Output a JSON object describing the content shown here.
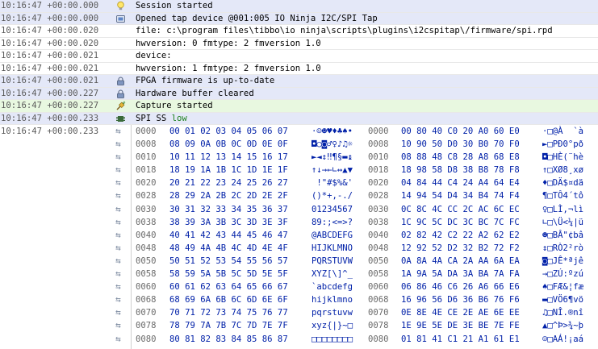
{
  "events": [
    {
      "ts": "10:16:47 +00:00.000",
      "icon": "lightbulb-icon",
      "tone": "blue",
      "text": "Session started",
      "hl": ""
    },
    {
      "ts": "10:16:47 +00:00.000",
      "icon": "device-icon",
      "tone": "blue",
      "text": "Opened tap device @001:005 IO Ninja I2C/SPI Tap",
      "hl": ""
    },
    {
      "ts": "10:16:47 +00:00.020",
      "icon": "",
      "tone": "white",
      "text": "file: c:\\program files\\tibbo\\io ninja\\scripts\\plugins\\i2cspitap\\/firmware/spi.rpd",
      "hl": ""
    },
    {
      "ts": "10:16:47 +00:00.020",
      "icon": "",
      "tone": "white",
      "text": "hwversion: 0 fmtype: 2 fmversion 1.0",
      "hl": ""
    },
    {
      "ts": "10:16:47 +00:00.021",
      "icon": "",
      "tone": "white",
      "text": "device:",
      "hl": ""
    },
    {
      "ts": "10:16:47 +00:00.021",
      "icon": "",
      "tone": "white",
      "text": "hwversion: 1 fmtype: 2 fmversion 1.0",
      "hl": ""
    },
    {
      "ts": "10:16:47 +00:00.021",
      "icon": "lock-icon",
      "tone": "blue",
      "text": "FPGA firmware is up-to-date",
      "hl": ""
    },
    {
      "ts": "10:16:47 +00:00.227",
      "icon": "lock-icon",
      "tone": "blue",
      "text": "Hardware buffer cleared",
      "hl": ""
    },
    {
      "ts": "10:16:47 +00:00.227",
      "icon": "plug-icon",
      "tone": "green",
      "text": "Capture started",
      "hl": ""
    },
    {
      "ts": "10:16:47 +00:00.233",
      "icon": "chip-icon",
      "tone": "blue",
      "text": "SPI SS ",
      "hl": "low"
    }
  ],
  "dump": {
    "ts": "10:16:47 +00:00.233",
    "rows": [
      {
        "o1": "0000",
        "h1": "00 01 02 03 04 05 06 07",
        "a1": "·☺☻♥♦♣♠•",
        "o2": "0000",
        "h2": "00 80 40 C0 20 A0 60 E0",
        "a2": "·□@À  `à"
      },
      {
        "o1": "0008",
        "h1": "08 09 0A 0B 0C 0D 0E 0F",
        "a1": "◘○◙♂♀♪♫☼",
        "o2": "0008",
        "h2": "10 90 50 D0 30 B0 70 F0",
        "a2": "►□PÐ0°pð"
      },
      {
        "o1": "0010",
        "h1": "10 11 12 13 14 15 16 17",
        "a1": "►◄↕‼¶§▬↨",
        "o2": "0010",
        "h2": "08 88 48 C8 28 A8 68 E8",
        "a2": "◘□HÈ(¨hè"
      },
      {
        "o1": "0018",
        "h1": "18 19 1A 1B 1C 1D 1E 1F",
        "a1": "↑↓→←∟↔▲▼",
        "o2": "0018",
        "h2": "18 98 58 D8 38 B8 78 F8",
        "a2": "↑□XØ8¸xø"
      },
      {
        "o1": "0020",
        "h1": "20 21 22 23 24 25 26 27",
        "a1": " !\"#$%&'",
        "o2": "0020",
        "h2": "04 84 44 C4 24 A4 64 E4",
        "a2": "♦□DÄ$¤dä"
      },
      {
        "o1": "0028",
        "h1": "28 29 2A 2B 2C 2D 2E 2F",
        "a1": "()*+,-./",
        "o2": "0028",
        "h2": "14 94 54 D4 34 B4 74 F4",
        "a2": "¶□TÔ4´tô"
      },
      {
        "o1": "0030",
        "h1": "30 31 32 33 34 35 36 37",
        "a1": "01234567",
        "o2": "0030",
        "h2": "0C 8C 4C CC 2C AC 6C EC",
        "a2": "♀□LÌ,¬lì"
      },
      {
        "o1": "0038",
        "h1": "38 39 3A 3B 3C 3D 3E 3F",
        "a1": "89:;<=>?",
        "o2": "0038",
        "h2": "1C 9C 5C DC 3C BC 7C FC",
        "a2": "∟□\\Ü<¼|ü"
      },
      {
        "o1": "0040",
        "h1": "40 41 42 43 44 45 46 47",
        "a1": "@ABCDEFG",
        "o2": "0040",
        "h2": "02 82 42 C2 22 A2 62 E2",
        "a2": "☻□BÂ\"¢bâ"
      },
      {
        "o1": "0048",
        "h1": "48 49 4A 4B 4C 4D 4E 4F",
        "a1": "HIJKLMNO",
        "o2": "0048",
        "h2": "12 92 52 D2 32 B2 72 F2",
        "a2": "↕□RÒ2²rò"
      },
      {
        "o1": "0050",
        "h1": "50 51 52 53 54 55 56 57",
        "a1": "PQRSTUVW",
        "o2": "0050",
        "h2": "0A 8A 4A CA 2A AA 6A EA",
        "a2": "◙□JÊ*ªjê"
      },
      {
        "o1": "0058",
        "h1": "58 59 5A 5B 5C 5D 5E 5F",
        "a1": "XYZ[\\]^_",
        "o2": "0058",
        "h2": "1A 9A 5A DA 3A BA 7A FA",
        "a2": "→□ZÚ:ºzú"
      },
      {
        "o1": "0060",
        "h1": "60 61 62 63 64 65 66 67",
        "a1": "`abcdefg",
        "o2": "0060",
        "h2": "06 86 46 C6 26 A6 66 E6",
        "a2": "♠□FÆ&¦fæ"
      },
      {
        "o1": "0068",
        "h1": "68 69 6A 6B 6C 6D 6E 6F",
        "a1": "hijklmno",
        "o2": "0068",
        "h2": "16 96 56 D6 36 B6 76 F6",
        "a2": "▬□VÖ6¶vö"
      },
      {
        "o1": "0070",
        "h1": "70 71 72 73 74 75 76 77",
        "a1": "pqrstuvw",
        "o2": "0070",
        "h2": "0E 8E 4E CE 2E AE 6E EE",
        "a2": "♫□NÎ.®nî"
      },
      {
        "o1": "0078",
        "h1": "78 79 7A 7B 7C 7D 7E 7F",
        "a1": "xyz{|}~□",
        "o2": "0078",
        "h2": "1E 9E 5E DE 3E BE 7E FE",
        "a2": "▲□^Þ>¾~þ"
      },
      {
        "o1": "0080",
        "h1": "80 81 82 83 84 85 86 87",
        "a1": "□□□□□□□□",
        "o2": "0080",
        "h2": "01 81 41 C1 21 A1 61 E1",
        "a2": "☺□AÁ!¡aá"
      }
    ]
  }
}
